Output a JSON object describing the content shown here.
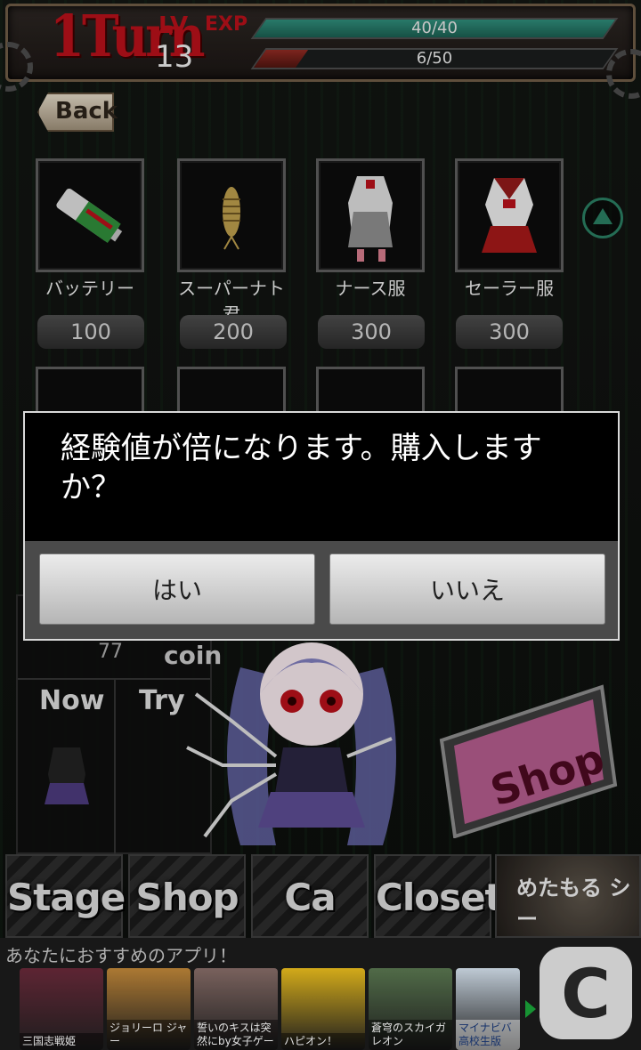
{
  "header": {
    "turn_label": "1Turn",
    "lv_label": "LV",
    "level": "13",
    "exp_tag": "EXP",
    "hp_text": "40/40",
    "hp_fraction": 1.0,
    "exp_text": "6/50",
    "exp_fraction": 0.12
  },
  "back_label": "Back",
  "items": [
    {
      "name": "バッテリー",
      "price": "100",
      "icon": "battery-icon"
    },
    {
      "name": "スーパーナト君",
      "price": "200",
      "icon": "larva-icon"
    },
    {
      "name": "ナース服",
      "price": "300",
      "icon": "nurse-outfit-icon"
    },
    {
      "name": "セーラー服",
      "price": "300",
      "icon": "sailor-outfit-icon"
    }
  ],
  "status": {
    "coin_count": "77",
    "coin_label": "coin",
    "now_label": "Now",
    "try_label": "Try"
  },
  "shop_sign": "Shop",
  "nav": {
    "stage": "Stage",
    "shop": "Shop",
    "ca": "Ca",
    "closet": "Closet",
    "metamorsea": "めたもる シー"
  },
  "ad": {
    "header": "あなたにおすすめのアプリ！",
    "apps": [
      {
        "label": "三国志戦姫",
        "color": "#6b2a3b"
      },
      {
        "label": "ジョリーロ ジャー",
        "color": "#c48a3a"
      },
      {
        "label": "誓いのキスは突 然にby女子ゲー",
        "color": "#8a6f6a"
      },
      {
        "label": "ハピオン！",
        "color": "#f0c21e"
      },
      {
        "label": "蒼穹のスカイガ レオン",
        "color": "#5c7a52"
      },
      {
        "label": "マイナビバ 高校生版",
        "color": "#d9e6f2"
      }
    ]
  },
  "dialog": {
    "message": "経験値が倍になります。購入しますか？",
    "yes": "はい",
    "no": "いいえ"
  },
  "colors": {
    "accent_red": "#b3101a",
    "hp_teal": "#2f8a78",
    "scroll_green": "#2a7b60"
  }
}
